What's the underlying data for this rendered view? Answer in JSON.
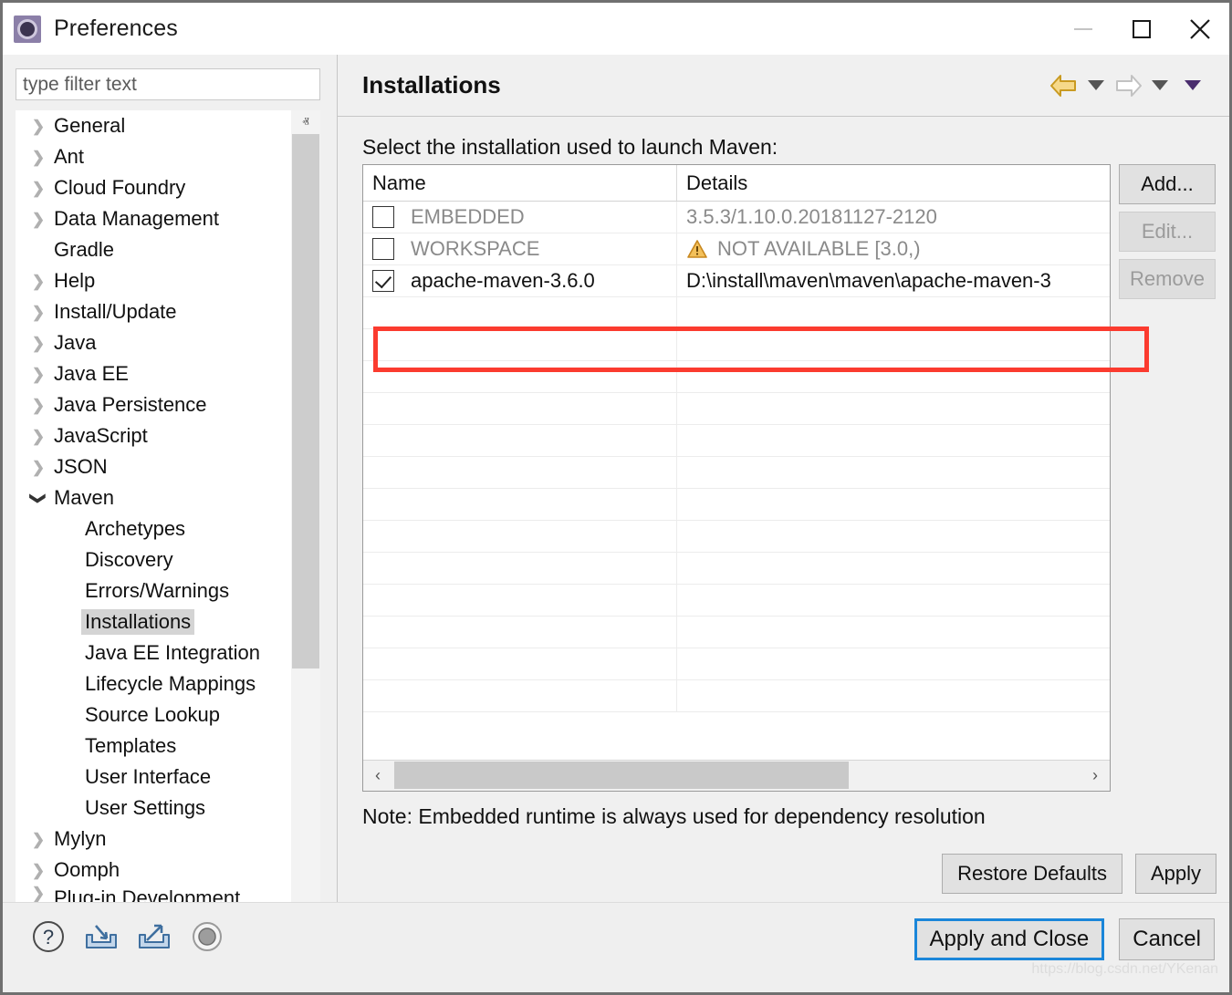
{
  "window": {
    "title": "Preferences",
    "icon": "eclipse-preferences-gear-icon",
    "controls": {
      "minimize": "—",
      "maximize": "□",
      "close": "✕"
    }
  },
  "sidebar": {
    "filter": {
      "placeholder": "type filter text",
      "value": ""
    },
    "items": [
      {
        "label": "General",
        "expandable": true,
        "expanded": false,
        "level": 0,
        "selected": false
      },
      {
        "label": "Ant",
        "expandable": true,
        "expanded": false,
        "level": 0,
        "selected": false
      },
      {
        "label": "Cloud Foundry",
        "expandable": true,
        "expanded": false,
        "level": 0,
        "selected": false
      },
      {
        "label": "Data Management",
        "expandable": true,
        "expanded": false,
        "level": 0,
        "selected": false
      },
      {
        "label": "Gradle",
        "expandable": false,
        "expanded": false,
        "level": 0,
        "selected": false
      },
      {
        "label": "Help",
        "expandable": true,
        "expanded": false,
        "level": 0,
        "selected": false
      },
      {
        "label": "Install/Update",
        "expandable": true,
        "expanded": false,
        "level": 0,
        "selected": false
      },
      {
        "label": "Java",
        "expandable": true,
        "expanded": false,
        "level": 0,
        "selected": false
      },
      {
        "label": "Java EE",
        "expandable": true,
        "expanded": false,
        "level": 0,
        "selected": false
      },
      {
        "label": "Java Persistence",
        "expandable": true,
        "expanded": false,
        "level": 0,
        "selected": false
      },
      {
        "label": "JavaScript",
        "expandable": true,
        "expanded": false,
        "level": 0,
        "selected": false
      },
      {
        "label": "JSON",
        "expandable": true,
        "expanded": false,
        "level": 0,
        "selected": false
      },
      {
        "label": "Maven",
        "expandable": true,
        "expanded": true,
        "level": 0,
        "selected": false
      },
      {
        "label": "Archetypes",
        "expandable": false,
        "expanded": false,
        "level": 1,
        "selected": false
      },
      {
        "label": "Discovery",
        "expandable": false,
        "expanded": false,
        "level": 1,
        "selected": false
      },
      {
        "label": "Errors/Warnings",
        "expandable": false,
        "expanded": false,
        "level": 1,
        "selected": false
      },
      {
        "label": "Installations",
        "expandable": false,
        "expanded": false,
        "level": 1,
        "selected": true
      },
      {
        "label": "Java EE Integration",
        "expandable": false,
        "expanded": false,
        "level": 1,
        "selected": false
      },
      {
        "label": "Lifecycle Mappings",
        "expandable": false,
        "expanded": false,
        "level": 1,
        "selected": false
      },
      {
        "label": "Source Lookup",
        "expandable": false,
        "expanded": false,
        "level": 1,
        "selected": false
      },
      {
        "label": "Templates",
        "expandable": false,
        "expanded": false,
        "level": 1,
        "selected": false
      },
      {
        "label": "User Interface",
        "expandable": false,
        "expanded": false,
        "level": 1,
        "selected": false
      },
      {
        "label": "User Settings",
        "expandable": false,
        "expanded": false,
        "level": 1,
        "selected": false
      },
      {
        "label": "Mylyn",
        "expandable": true,
        "expanded": false,
        "level": 0,
        "selected": false
      },
      {
        "label": "Oomph",
        "expandable": true,
        "expanded": false,
        "level": 0,
        "selected": false
      },
      {
        "label": "Plug-in Development",
        "expandable": true,
        "expanded": false,
        "level": 0,
        "selected": false
      }
    ],
    "scrollbar": {
      "up_arrow": "ⱏ",
      "down_arrow": "ⱟ"
    }
  },
  "page": {
    "title": "Installations",
    "nav": {
      "back_icon": "back-arrow-icon",
      "back_dropdown": "▼",
      "forward_icon": "forward-arrow-icon",
      "forward_dropdown": "▼",
      "menu_dropdown": "▼"
    },
    "section_label": "Select the installation used to launch Maven:",
    "note": "Note: Embedded runtime is always used for dependency resolution"
  },
  "table": {
    "columns": [
      "Name",
      "Details"
    ],
    "rows": [
      {
        "checked": false,
        "enabled": false,
        "name": "EMBEDDED",
        "details": "3.5.3/1.10.0.20181127-2120",
        "warning": false,
        "highlighted": false
      },
      {
        "checked": false,
        "enabled": false,
        "name": "WORKSPACE",
        "details": "NOT AVAILABLE [3.0,)",
        "warning": true,
        "highlighted": false
      },
      {
        "checked": true,
        "enabled": true,
        "name": "apache-maven-3.6.0",
        "details": "D:\\install\\maven\\maven\\apache-maven-3",
        "warning": false,
        "highlighted": true
      }
    ],
    "empty_row_count": 13,
    "hscroll": {
      "left_arrow": "‹",
      "right_arrow": "›"
    }
  },
  "side_buttons": [
    {
      "label": "Add...",
      "enabled": true
    },
    {
      "label": "Edit...",
      "enabled": false
    },
    {
      "label": "Remove",
      "enabled": false
    }
  ],
  "page_buttons": [
    {
      "label": "Restore Defaults",
      "enabled": true
    },
    {
      "label": "Apply",
      "enabled": true
    }
  ],
  "footer": {
    "icons": [
      "help-icon",
      "import-icon",
      "export-icon",
      "toggle-icon"
    ],
    "buttons": [
      {
        "label": "Apply and Close",
        "focused": true
      },
      {
        "label": "Cancel",
        "focused": false
      }
    ],
    "watermark": "https://blog.csdn.net/YKenan"
  },
  "colors": {
    "accent_blue": "#1a86d9",
    "highlight_red": "#fb3b2f",
    "warning_amber": "#e9a93a",
    "nav_gold": "#e3b23c",
    "nav_purple": "#4a2d6e",
    "selection_gray": "#d4d4d4"
  }
}
